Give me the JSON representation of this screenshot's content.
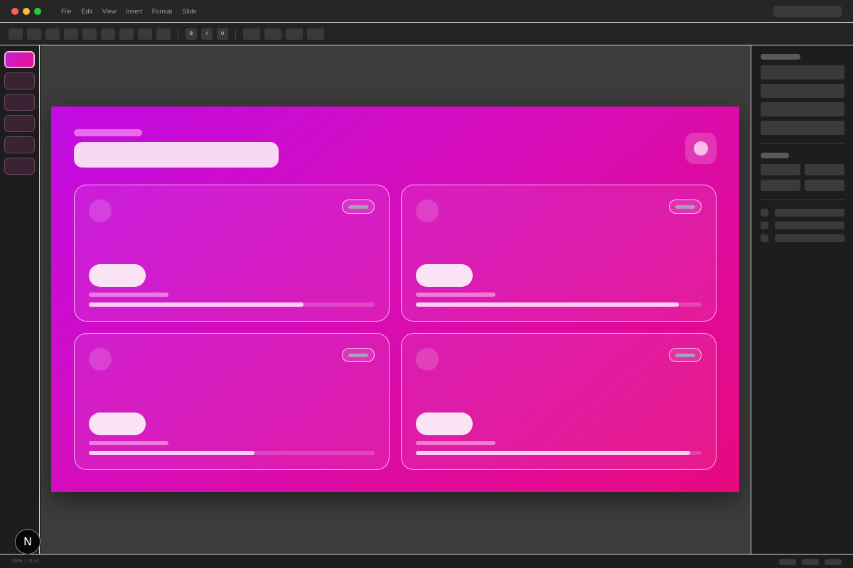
{
  "window": {
    "menu": [
      "File",
      "Edit",
      "View",
      "Insert",
      "Format",
      "Slide"
    ]
  },
  "toolbar": {
    "bold": "B",
    "italic": "I",
    "underline": "U"
  },
  "slides": {
    "count": 6,
    "active_index": 0
  },
  "slide": {
    "gradient_colors": [
      "#c20ce4",
      "#d60cb8",
      "#e8097e"
    ],
    "cards": [
      {
        "progress": 0.75
      },
      {
        "progress": 0.92
      },
      {
        "progress": 0.58
      },
      {
        "progress": 0.96
      }
    ]
  },
  "status": {
    "text": "Slide 1 of 24"
  },
  "logo": {
    "glyph": "N"
  }
}
